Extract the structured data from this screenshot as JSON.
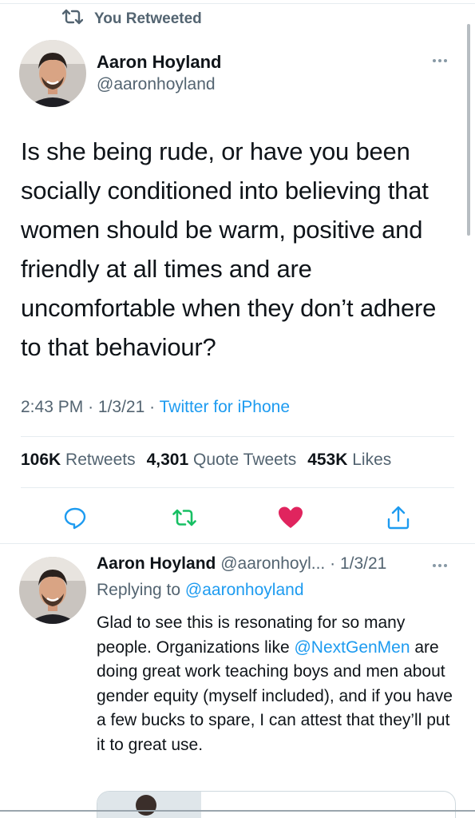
{
  "retweet_banner": {
    "label": "You Retweeted",
    "icon": "retweet-icon"
  },
  "tweet": {
    "author_name": "Aaron Hoyland",
    "author_handle": "@aaronhoyland",
    "text": "Is she being rude, or have you been socially conditioned into believing that women should be warm, positive and friendly at all times and are uncomfortable when they don’t adhere to that behaviour?",
    "time": "2:43 PM",
    "sep1": "·",
    "date": "1/3/21",
    "sep2": "·",
    "source": "Twitter for iPhone",
    "stats": {
      "retweets_count": "106K",
      "retweets_label": "Retweets",
      "quotes_count": "4,301",
      "quotes_label": "Quote Tweets",
      "likes_count": "453K",
      "likes_label": "Likes"
    },
    "actions": [
      "reply-icon",
      "retweet-icon",
      "like-icon",
      "share-icon"
    ]
  },
  "reply": {
    "author_name": "Aaron Hoyland",
    "author_handle": "@aaronhoyl...",
    "sep": "·",
    "date": "1/3/21",
    "replying_prefix": "Replying to",
    "replying_handle": "@aaronhoyland",
    "text_before": "Glad to see this is resonating for so many people. Organizations like ",
    "mention": "@NextGenMen",
    "text_after": " are doing great work teaching boys and men about gender equity (myself included), and if you have a few bucks to spare, I can attest that they’ll put it to great use."
  },
  "colors": {
    "accent": "#1d9bf0",
    "retweet_green": "#17bf63",
    "like_red": "#e0245e",
    "secondary_text": "#536471"
  }
}
